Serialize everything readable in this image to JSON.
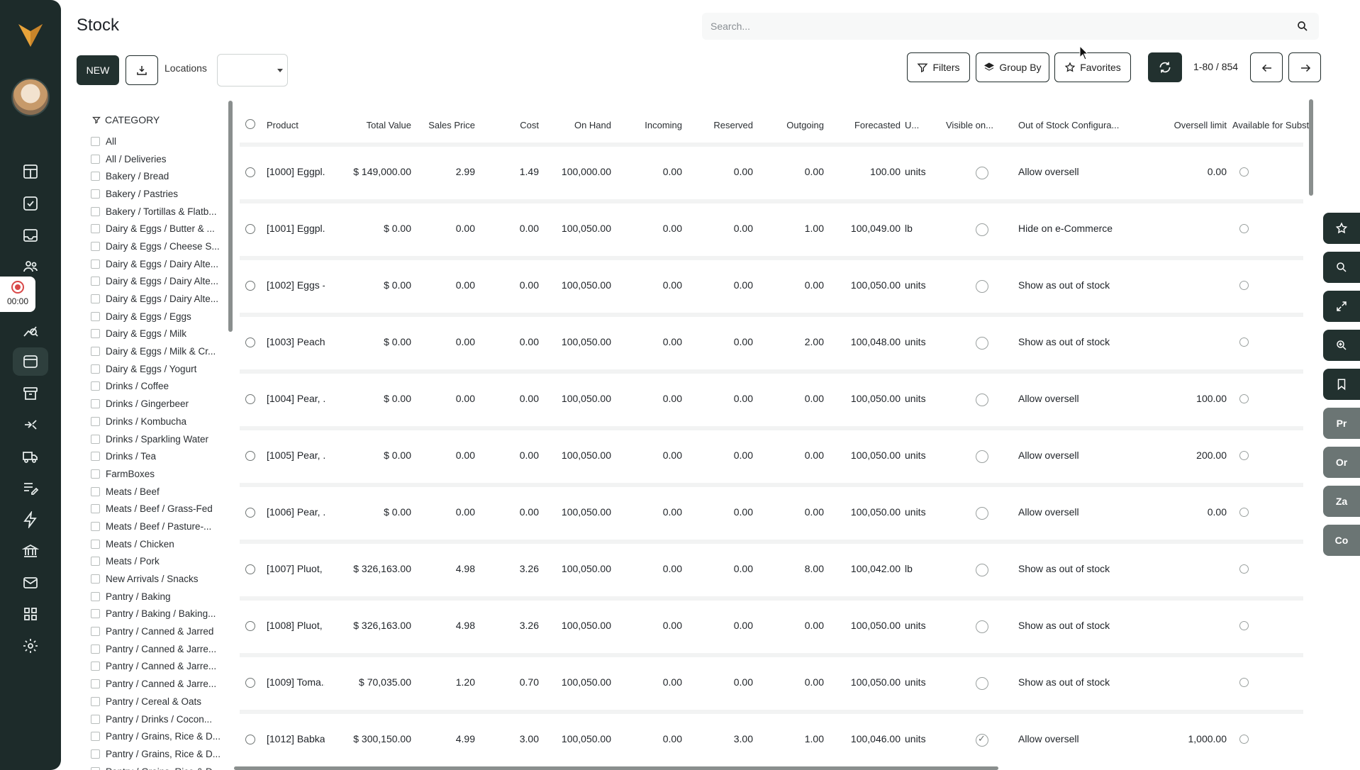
{
  "app": {
    "title": "Stock"
  },
  "search": {
    "placeholder": "Search..."
  },
  "toolbar": {
    "new_label": "NEW",
    "locations_label": "Locations",
    "filters_label": "Filters",
    "groupby_label": "Group By",
    "favorites_label": "Favorites",
    "pager": "1-80 / 854"
  },
  "recorder": {
    "time": "00:00"
  },
  "category": {
    "heading": "CATEGORY",
    "items": [
      "All",
      "All / Deliveries",
      "Bakery / Bread",
      "Bakery / Pastries",
      "Bakery / Tortillas & Flatb...",
      "Dairy & Eggs / Butter & ...",
      "Dairy & Eggs / Cheese S...",
      "Dairy & Eggs / Dairy Alte...",
      "Dairy & Eggs / Dairy Alte...",
      "Dairy & Eggs / Dairy Alte...",
      "Dairy & Eggs / Eggs",
      "Dairy & Eggs / Milk",
      "Dairy & Eggs / Milk & Cr...",
      "Dairy & Eggs / Yogurt",
      "Drinks / Coffee",
      "Drinks / Gingerbeer",
      "Drinks / Kombucha",
      "Drinks / Sparkling Water",
      "Drinks / Tea",
      "FarmBoxes",
      "Meats / Beef",
      "Meats / Beef / Grass-Fed",
      "Meats / Beef / Pasture-...",
      "Meats / Chicken",
      "Meats / Pork",
      "New Arrivals / Snacks",
      "Pantry / Baking",
      "Pantry / Baking / Baking...",
      "Pantry / Canned & Jarred",
      "Pantry / Canned & Jarre...",
      "Pantry / Canned & Jarre...",
      "Pantry / Canned & Jarre...",
      "Pantry / Cereal & Oats",
      "Pantry / Drinks / Cocon...",
      "Pantry / Grains, Rice & D...",
      "Pantry / Grains, Rice & D...",
      "Pantry / Grains, Rice & D..."
    ]
  },
  "table": {
    "headers": {
      "product": "Product",
      "total_value": "Total Value",
      "sales_price": "Sales Price",
      "cost": "Cost",
      "on_hand": "On Hand",
      "incoming": "Incoming",
      "reserved": "Reserved",
      "outgoing": "Outgoing",
      "forecasted": "Forecasted",
      "uom": "U...",
      "visible": "Visible on...",
      "oos_config": "Out of Stock Configura...",
      "oversell": "Oversell limit",
      "available_subst": "Available for Subst"
    },
    "rows": [
      {
        "product": "[1000] Eggpl...",
        "total_value": "$ 149,000.00",
        "sales_price": "2.99",
        "cost": "1.49",
        "on_hand": "100,000.00",
        "incoming": "0.00",
        "reserved": "0.00",
        "outgoing": "0.00",
        "forecasted": "100.00",
        "uom": "units",
        "visible": false,
        "oos": "Allow oversell",
        "oversell": "0.00"
      },
      {
        "product": "[1001] Eggpl...",
        "total_value": "$ 0.00",
        "sales_price": "0.00",
        "cost": "0.00",
        "on_hand": "100,050.00",
        "incoming": "0.00",
        "reserved": "0.00",
        "outgoing": "1.00",
        "forecasted": "100,049.00",
        "uom": "lb",
        "visible": false,
        "oos": "Hide on e-Commerce",
        "oversell": ""
      },
      {
        "product": "[1002] Eggs -...",
        "total_value": "$ 0.00",
        "sales_price": "0.00",
        "cost": "0.00",
        "on_hand": "100,050.00",
        "incoming": "0.00",
        "reserved": "0.00",
        "outgoing": "0.00",
        "forecasted": "100,050.00",
        "uom": "units",
        "visible": false,
        "oos": "Show as out of stock",
        "oversell": ""
      },
      {
        "product": "[1003] Peach...",
        "total_value": "$ 0.00",
        "sales_price": "0.00",
        "cost": "0.00",
        "on_hand": "100,050.00",
        "incoming": "0.00",
        "reserved": "0.00",
        "outgoing": "2.00",
        "forecasted": "100,048.00",
        "uom": "units",
        "visible": false,
        "oos": "Show as out of stock",
        "oversell": ""
      },
      {
        "product": "[1004] Pear, ...",
        "total_value": "$ 0.00",
        "sales_price": "0.00",
        "cost": "0.00",
        "on_hand": "100,050.00",
        "incoming": "0.00",
        "reserved": "0.00",
        "outgoing": "0.00",
        "forecasted": "100,050.00",
        "uom": "units",
        "visible": false,
        "oos": "Allow oversell",
        "oversell": "100.00"
      },
      {
        "product": "[1005] Pear, ...",
        "total_value": "$ 0.00",
        "sales_price": "0.00",
        "cost": "0.00",
        "on_hand": "100,050.00",
        "incoming": "0.00",
        "reserved": "0.00",
        "outgoing": "0.00",
        "forecasted": "100,050.00",
        "uom": "units",
        "visible": false,
        "oos": "Allow oversell",
        "oversell": "200.00"
      },
      {
        "product": "[1006] Pear, ...",
        "total_value": "$ 0.00",
        "sales_price": "0.00",
        "cost": "0.00",
        "on_hand": "100,050.00",
        "incoming": "0.00",
        "reserved": "0.00",
        "outgoing": "0.00",
        "forecasted": "100,050.00",
        "uom": "units",
        "visible": false,
        "oos": "Allow oversell",
        "oversell": "0.00"
      },
      {
        "product": "[1007] Pluot, ...",
        "total_value": "$ 326,163.00",
        "sales_price": "4.98",
        "cost": "3.26",
        "on_hand": "100,050.00",
        "incoming": "0.00",
        "reserved": "0.00",
        "outgoing": "8.00",
        "forecasted": "100,042.00",
        "uom": "lb",
        "visible": false,
        "oos": "Show as out of stock",
        "oversell": ""
      },
      {
        "product": "[1008] Pluot, ...",
        "total_value": "$ 326,163.00",
        "sales_price": "4.98",
        "cost": "3.26",
        "on_hand": "100,050.00",
        "incoming": "0.00",
        "reserved": "0.00",
        "outgoing": "0.00",
        "forecasted": "100,050.00",
        "uom": "units",
        "visible": false,
        "oos": "Show as out of stock",
        "oversell": ""
      },
      {
        "product": "[1009] Toma...",
        "total_value": "$ 70,035.00",
        "sales_price": "1.20",
        "cost": "0.70",
        "on_hand": "100,050.00",
        "incoming": "0.00",
        "reserved": "0.00",
        "outgoing": "0.00",
        "forecasted": "100,050.00",
        "uom": "units",
        "visible": false,
        "oos": "Show as out of stock",
        "oversell": ""
      },
      {
        "product": "[1012] Babka...",
        "total_value": "$ 300,150.00",
        "sales_price": "4.99",
        "cost": "3.00",
        "on_hand": "100,050.00",
        "incoming": "0.00",
        "reserved": "3.00",
        "outgoing": "1.00",
        "forecasted": "100,046.00",
        "uom": "units",
        "visible": true,
        "oos": "Allow oversell",
        "oversell": "1,000.00"
      }
    ]
  },
  "dock": {
    "items": [
      "star-icon",
      "search-icon",
      "expand-icon",
      "zoom-icon",
      "bookmark-icon"
    ],
    "tabs": [
      "Pr",
      "Or",
      "Za",
      "Co"
    ]
  },
  "colors": {
    "rail": "#1d2b2a",
    "primary": "#22312f",
    "dock_gray": "#6b7574"
  }
}
